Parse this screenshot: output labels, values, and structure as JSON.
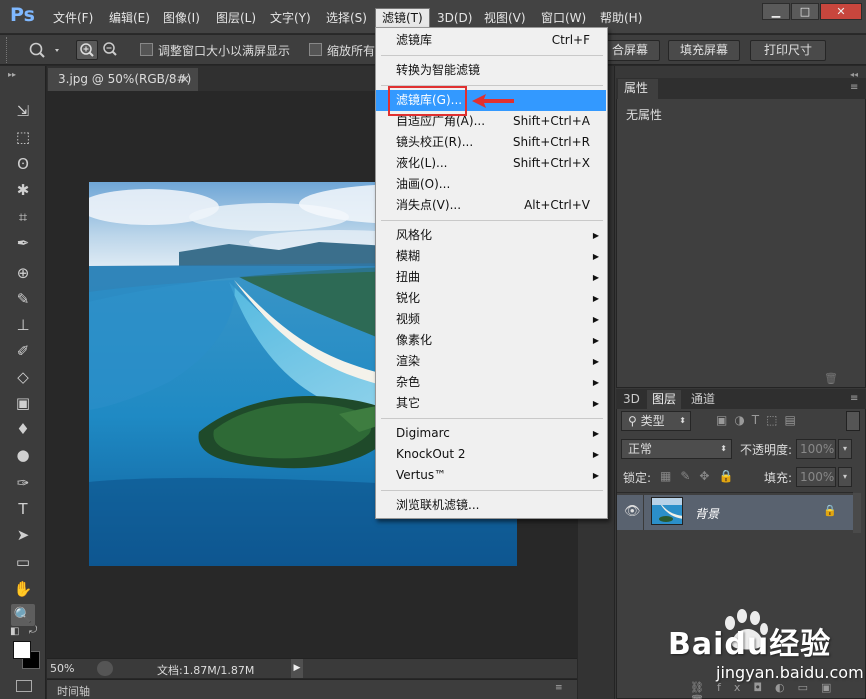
{
  "app": {
    "logo": "Ps"
  },
  "menubar": {
    "items": [
      "文件(F)",
      "编辑(E)",
      "图像(I)",
      "图层(L)",
      "文字(Y)",
      "选择(S)",
      "滤镜(T)",
      "3D(D)",
      "视图(V)",
      "窗口(W)",
      "帮助(H)"
    ],
    "active": "滤镜(T)"
  },
  "window_controls": {
    "minimize": "▁",
    "maximize": "□",
    "close": "✕"
  },
  "options": {
    "resize_windows_label": "调整窗口大小以满屏显示",
    "zoom_all_label": "缩放所有",
    "fit_screen_label": "合屏幕",
    "fill_screen_label": "填充屏幕",
    "print_size_label": "打印尺寸"
  },
  "document": {
    "tab_label": "3.jpg @ 50%(RGB/8#)",
    "tab_close": "×",
    "zoom": "50%",
    "doc_info": "文档:1.87M/1.87M",
    "timeline_label": "时间轴"
  },
  "filter_menu": {
    "groups": [
      [
        {
          "label": "滤镜库",
          "shortcut": "Ctrl+F"
        }
      ],
      [
        {
          "label": "转换为智能滤镜",
          "shortcut": ""
        }
      ],
      [
        {
          "label": "滤镜库(G)...",
          "shortcut": "",
          "highlight": true
        },
        {
          "label": "自适应广角(A)...",
          "shortcut": "Shift+Ctrl+A"
        },
        {
          "label": "镜头校正(R)...",
          "shortcut": "Shift+Ctrl+R"
        },
        {
          "label": "液化(L)...",
          "shortcut": "Shift+Ctrl+X"
        },
        {
          "label": "油画(O)...",
          "shortcut": ""
        },
        {
          "label": "消失点(V)...",
          "shortcut": "Alt+Ctrl+V"
        }
      ],
      [
        {
          "label": "风格化",
          "submenu": true
        },
        {
          "label": "模糊",
          "submenu": true
        },
        {
          "label": "扭曲",
          "submenu": true
        },
        {
          "label": "锐化",
          "submenu": true
        },
        {
          "label": "视频",
          "submenu": true
        },
        {
          "label": "像素化",
          "submenu": true
        },
        {
          "label": "渲染",
          "submenu": true
        },
        {
          "label": "杂色",
          "submenu": true
        },
        {
          "label": "其它",
          "submenu": true
        }
      ],
      [
        {
          "label": "Digimarc",
          "submenu": true
        },
        {
          "label": "KnockOut 2",
          "submenu": true
        },
        {
          "label": "Vertus™",
          "submenu": true
        }
      ],
      [
        {
          "label": "浏览联机滤镜...",
          "shortcut": ""
        }
      ]
    ]
  },
  "properties_panel": {
    "tab": "属性",
    "content": "无属性"
  },
  "layers_panel": {
    "tabs": [
      "3D",
      "图层",
      "通道"
    ],
    "active_tab": "图层",
    "kind_filter": "类型",
    "blend_mode": "正常",
    "opacity_label": "不透明度:",
    "opacity_value": "100%",
    "lock_label": "锁定:",
    "fill_label": "填充:",
    "fill_value": "100%",
    "layers": [
      {
        "name": "背景",
        "visible": true,
        "locked": true
      }
    ]
  },
  "watermark": {
    "brand": "Baidu经验",
    "url": "jingyan.baidu.com"
  },
  "colors": {
    "highlight": "#3399ff",
    "annotation": "#e03030",
    "menu_bg": "#f0f0f0",
    "ui_dark": "#3c3c3c"
  }
}
